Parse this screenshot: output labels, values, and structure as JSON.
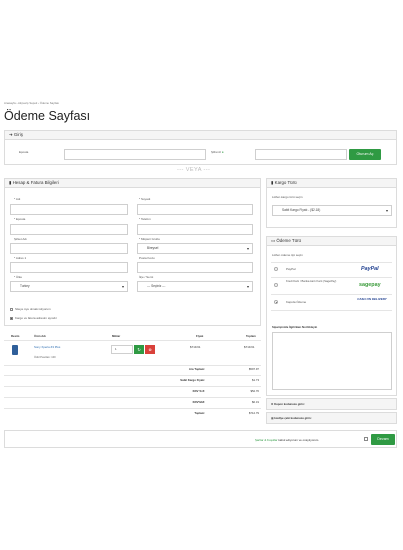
{
  "breadcrumb": [
    "Anasayfa",
    "Alışveriş Sepeti",
    "Ödeme Sayfası"
  ],
  "page_title": "Ödeme Sayfası",
  "login": {
    "header": "Giriş",
    "email_label": "Eposta",
    "password_label": "Şifreniz",
    "submit": "Oturum Aç"
  },
  "divider_text": "--- VEYA ---",
  "billing": {
    "header": "Hesap & Fatura Bilgileri",
    "name_label": "* Adı",
    "surname_label": "* Soyadı",
    "email_label": "* Eposta",
    "phone_label": "* Telefon",
    "company_label": "Şirket Adı",
    "customer_group_label": "* Müşteri Grubu",
    "customer_group_value": "Bireysel",
    "address_label": "* Adres 1",
    "postcode_label": "Posta Kodu",
    "country_label": "* Ülke",
    "country_value": "Turkey",
    "district_label": "İlçe / Semt",
    "district_value": "--- Seçiniz ---",
    "chk_register": "Siteye üye olmak istiyorum",
    "chk_same_address": "Kargo ve fatura adresim aynıdır"
  },
  "cart": {
    "headers": [
      "Resim",
      "Ürün Adı",
      "Miktar",
      "Fiyatı",
      "Toplam"
    ],
    "item": {
      "name": "Sony Xperia Z3 Plus",
      "points": "Ödül Puanları: 100",
      "qty": "1",
      "price": "$719.61",
      "total": "$719.61"
    },
    "totals": [
      {
        "label": "Ara Toplam:",
        "value": "$597.97"
      },
      {
        "label": "Sabit Kargo Fiyatı:",
        "value": "$1.73"
      },
      {
        "label": "KDV % 8:",
        "value": "$52.76"
      },
      {
        "label": "KDV%18:",
        "value": "$0.31"
      },
      {
        "label": "Toplam:",
        "value": "$712.79"
      }
    ]
  },
  "shipping": {
    "header": "Kargo Türü",
    "hint": "Lütfen kargo türü seçin",
    "selected": "Sabit Kargo Fiyatı - ($2.18)"
  },
  "payment": {
    "header": "Ödeme Türü",
    "hint": "Lütfen ödeme tipi seçin",
    "options": [
      {
        "label": "PayPal",
        "logo": "PayPal"
      },
      {
        "label": "Kredi Kartı / Banka kartı Kartı (SagePay)",
        "logo": "sagepay"
      },
      {
        "label": "Kapıda Ödeme",
        "logo": "CASH ON DELIVERY"
      }
    ],
    "note_label": "Siparişinizle İlgili Bazı Not Ekleyin"
  },
  "coupon": "Kupon kodunuzu girin:",
  "voucher": "Hediye çeki kodunuzu girin:",
  "terms": {
    "link": "Şartlar & Koşullar",
    "text": "kabul ediyorum ve onaylıyorum.",
    "button": "Devam"
  },
  "colors": {
    "green": "#2f9a43",
    "blue": "#2b6cb0",
    "red": "#d9413a"
  }
}
